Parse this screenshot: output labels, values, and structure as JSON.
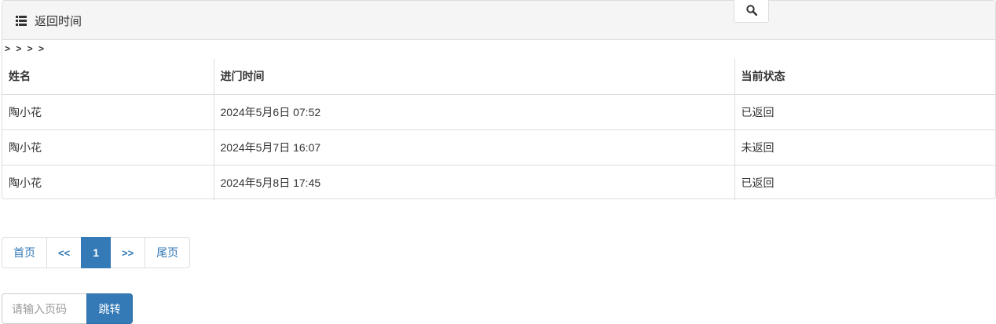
{
  "panel": {
    "title": "返回时间",
    "title_icon": "list-icon",
    "search_icon": "search-icon"
  },
  "breadcrumb": "> > > >",
  "table": {
    "columns": [
      "姓名",
      "进门时间",
      "当前状态"
    ],
    "rows": [
      [
        "陶小花",
        "2024年5月6日 07:52",
        "已返回"
      ],
      [
        "陶小花",
        "2024年5月7日 16:07",
        "未返回"
      ],
      [
        "陶小花",
        "2024年5月8日 17:45",
        "已返回"
      ]
    ]
  },
  "pagination": {
    "first": "首页",
    "prev": "<<",
    "current": "1",
    "next": ">>",
    "last": "尾页"
  },
  "jump": {
    "placeholder": "请输入页码",
    "button": "跳转"
  },
  "colors": {
    "accent": "#337ab7",
    "border": "#dddddd",
    "heading_bg": "#f5f5f5"
  }
}
